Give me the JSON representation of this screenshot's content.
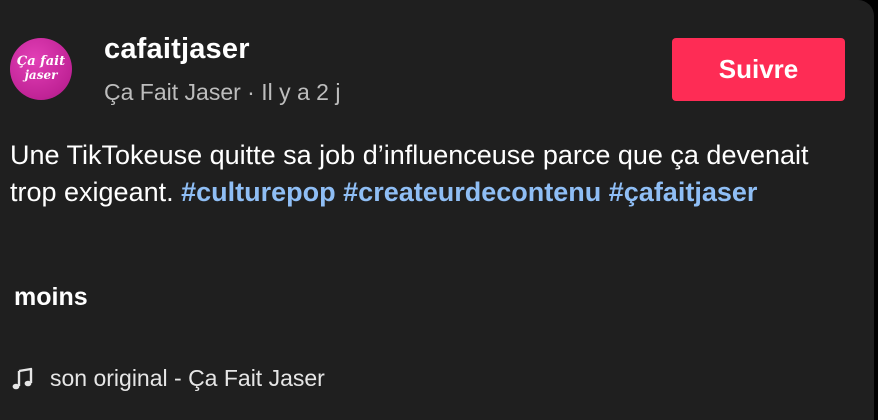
{
  "post": {
    "avatar": {
      "logo_line1": "Ça fait",
      "logo_line2": "jaser",
      "icon": "brand-logo-icon"
    },
    "username": "cafaitjaser",
    "display_name": "Ça Fait Jaser",
    "separator": " · ",
    "timestamp": "Il y a 2 j",
    "follow_label": "Suivre",
    "caption_text": "Une TikTokeuse quitte sa job d’influenceuse parce que ça devenait trop exigeant.",
    "hashtags": [
      "#culturepop",
      "#createurdecontenu",
      "#çafaitjaser"
    ],
    "less_label": "moins",
    "sound_label": "son original - Ça Fait Jaser",
    "sound_icon": "music-note-icon"
  },
  "colors": {
    "background": "#1f1f1f",
    "follow_button": "#fe2c55",
    "hashtag": "#8fbef5",
    "avatar": "#c02396"
  }
}
